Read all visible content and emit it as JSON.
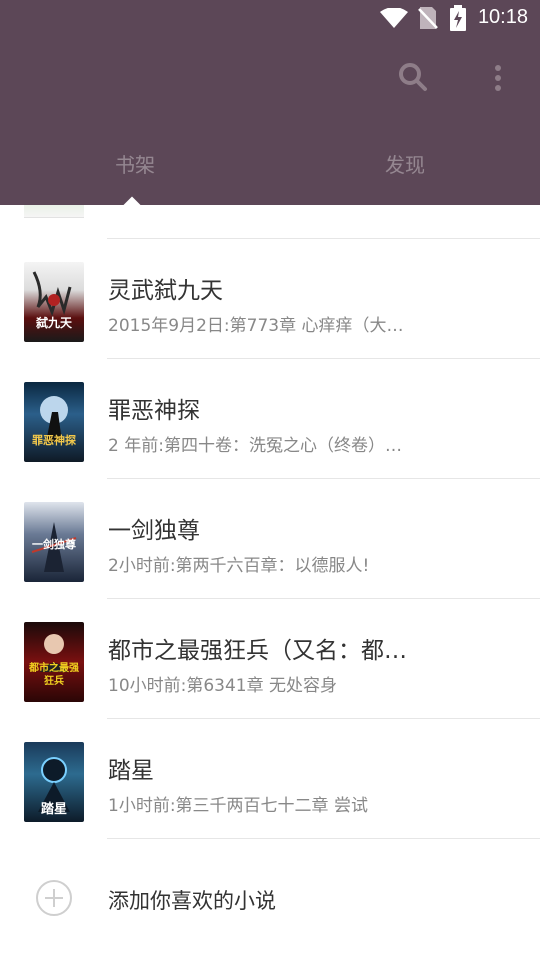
{
  "status_bar": {
    "time": "10:18"
  },
  "tabs": [
    {
      "label": "书架"
    },
    {
      "label": "发现"
    }
  ],
  "books": [
    {
      "title": "灵武弑九天",
      "subtitle": "2015年9月2日:第773章 心痒痒（大…",
      "cover_text": "弑九天"
    },
    {
      "title": "罪恶神探",
      "subtitle": "2 年前:第四十卷：洗冤之心（终卷）…",
      "cover_text": "罪恶神探"
    },
    {
      "title": "一剑独尊",
      "subtitle": "2小时前:第两千六百章：以德服人!",
      "cover_text": "一剑独尊"
    },
    {
      "title": "都市之最强狂兵（又名：都…",
      "subtitle": "10小时前:第6341章 无处容身",
      "cover_text": "都市之最强狂兵"
    },
    {
      "title": "踏星",
      "subtitle": "1小时前:第三千两百七十二章 尝试",
      "cover_text": "踏星"
    }
  ],
  "add_novel": {
    "label": "添加你喜欢的小说"
  },
  "colors": {
    "header": "#5c4757",
    "text_primary": "#333333",
    "text_secondary": "#888888",
    "divider": "#e6e6e6"
  }
}
